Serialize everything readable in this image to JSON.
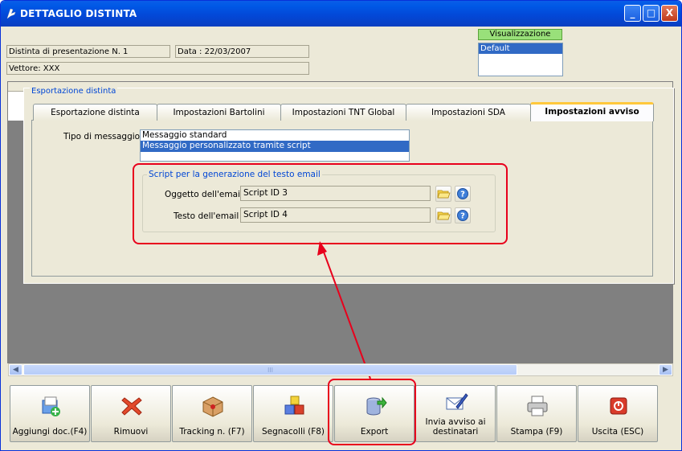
{
  "window": {
    "title": "DETTAGLIO DISTINTA",
    "controls": {
      "minimize": "_",
      "maximize": "□",
      "close": "X"
    }
  },
  "header": {
    "distinta": "Distinta di presentazione N. 1",
    "data": "Data : 22/03/2007",
    "vettore": "Vettore: XXX"
  },
  "visualizzazione": {
    "title": "Visualizzazione",
    "options": [
      "Default"
    ],
    "selected": "Default"
  },
  "export_panel": {
    "group_title": "Esportazione distinta",
    "tabs": [
      {
        "label": "Esportazione distinta",
        "active": false
      },
      {
        "label": "Impostazioni Bartolini",
        "active": false
      },
      {
        "label": "Impostazioni TNT Global",
        "active": false
      },
      {
        "label": "Impostazioni SDA",
        "active": false
      },
      {
        "label": "Impostazioni avviso",
        "active": true
      }
    ],
    "tipo_label": "Tipo di messaggio :",
    "message_types": [
      "Messaggio standard",
      "Messaggio personalizzato tramite script"
    ],
    "selected_message_type": "Messaggio personalizzato tramite script",
    "script_group": {
      "title": "Script per la generazione del testo email",
      "oggetto_label": "Oggetto dell'email :",
      "oggetto_value": "Script ID 3",
      "testo_label": "Testo dell'email :",
      "testo_value": "Script ID 4"
    }
  },
  "toolbar": {
    "buttons": [
      {
        "label": "Aggiungi doc.(F4)",
        "icon": "add-document-icon"
      },
      {
        "label": "Rimuovi",
        "icon": "remove-x-icon"
      },
      {
        "label": "Tracking n. (F7)",
        "icon": "package-icon"
      },
      {
        "label": "Segnacolli (F8)",
        "icon": "shapes-icon"
      },
      {
        "label": "Export",
        "icon": "database-export-icon"
      },
      {
        "label": "Invia avviso ai destinatari",
        "icon": "email-pen-icon"
      },
      {
        "label": "Stampa (F9)",
        "icon": "printer-icon"
      },
      {
        "label": "Uscita (ESC)",
        "icon": "power-exit-icon"
      }
    ]
  },
  "scrollbar": {
    "thumb_glyph": "III"
  },
  "colors": {
    "titlebar": "#0058e6",
    "selection": "#316ac5",
    "highlight_box": "#e8001c",
    "group_title": "#0046d5",
    "visualizzazione_header": "#99e07a"
  }
}
